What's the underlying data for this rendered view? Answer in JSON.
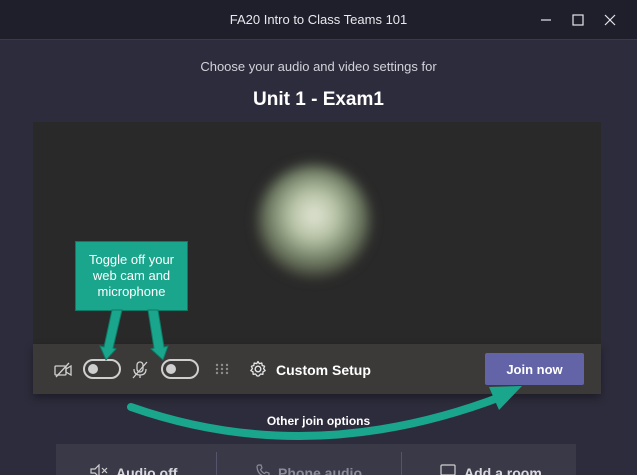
{
  "window": {
    "title": "FA20 Intro to Class Teams 101",
    "icons": [
      "minimize-icon",
      "maximize-icon",
      "close-icon"
    ]
  },
  "prejoin": {
    "subtitle": "Choose your audio and video settings for",
    "meeting_title": "Unit 1 - Exam1"
  },
  "controls": {
    "camera_toggle_state": "off",
    "mic_toggle_state": "off",
    "custom_setup_label": "Custom Setup",
    "join_label": "Join now"
  },
  "callout": {
    "text": "Toggle off your web cam and microphone"
  },
  "other": {
    "label": "Other join options",
    "audio_off": "Audio off",
    "phone_audio": "Phone audio",
    "add_room": "Add a room"
  },
  "colors": {
    "background": "#2d2c3c",
    "accent": "#6264a7",
    "callout": "#1aa68c"
  }
}
